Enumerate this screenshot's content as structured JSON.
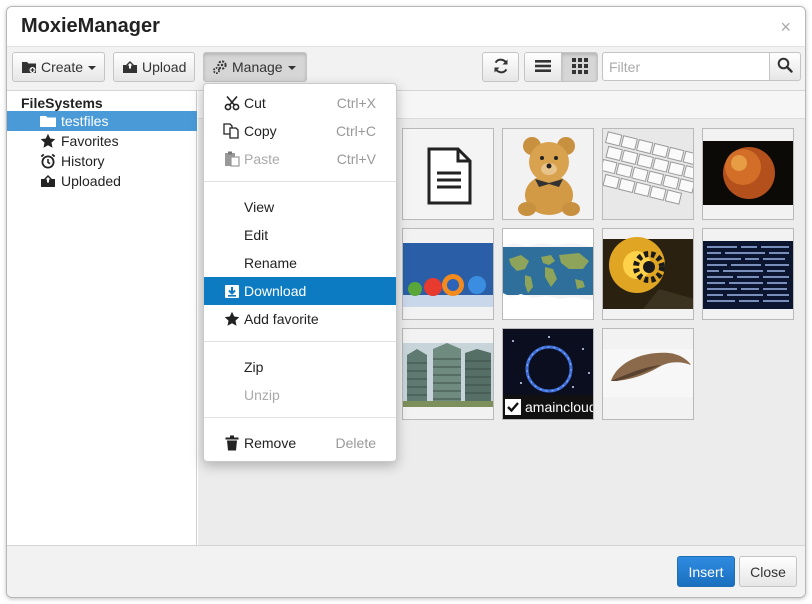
{
  "window": {
    "title": "MoxieManager",
    "close_glyph": "×"
  },
  "toolbar": {
    "create_label": "Create",
    "upload_label": "Upload",
    "manage_label": "Manage",
    "filter_placeholder": "Filter"
  },
  "sidebar": {
    "root_label": "FileSystems",
    "items": [
      {
        "label": "testfiles",
        "icon": "folder-icon",
        "selected": true
      },
      {
        "label": "Favorites",
        "icon": "star-icon"
      },
      {
        "label": "History",
        "icon": "alarm-clock-icon"
      },
      {
        "label": "Uploaded",
        "icon": "upload-folder-icon"
      }
    ]
  },
  "thumbnails": [
    {
      "kind": "document-file"
    },
    {
      "kind": "teddy-bear-photo"
    },
    {
      "kind": "keyboard-photo"
    },
    {
      "kind": "planet-photo"
    },
    {
      "kind": "browser-icons-photo"
    },
    {
      "kind": "world-map-photo"
    },
    {
      "kind": "gear-photo"
    },
    {
      "kind": "code-screen-photo"
    },
    {
      "kind": "buildings-photo"
    },
    {
      "kind": "space-circle-photo",
      "label": "amaincloud",
      "checked": true
    },
    {
      "kind": "claw-photo"
    }
  ],
  "context_menu": {
    "items": [
      {
        "label": "Cut",
        "shortcut": "Ctrl+X",
        "icon": "scissors-icon"
      },
      {
        "label": "Copy",
        "shortcut": "Ctrl+C",
        "icon": "copy-icon"
      },
      {
        "label": "Paste",
        "shortcut": "Ctrl+V",
        "icon": "paste-icon",
        "disabled": true
      },
      {
        "label": "View"
      },
      {
        "label": "Edit"
      },
      {
        "label": "Rename"
      },
      {
        "label": "Download",
        "icon": "download-icon",
        "highlighted": true
      },
      {
        "label": "Add favorite",
        "icon": "star-icon"
      },
      {
        "label": "Zip"
      },
      {
        "label": "Unzip",
        "disabled": true
      },
      {
        "label": "Remove",
        "shortcut": "Delete",
        "icon": "trash-icon"
      }
    ]
  },
  "footer": {
    "insert_label": "Insert",
    "close_label": "Close"
  },
  "colors": {
    "accent": "#0d7bc1",
    "selection": "#4a9ad8",
    "primary_button": "#1a6fbf"
  }
}
